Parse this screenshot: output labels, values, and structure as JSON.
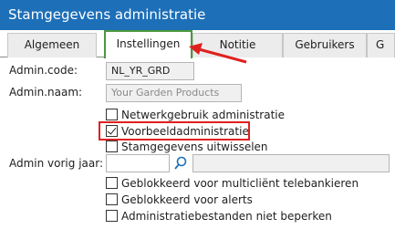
{
  "window": {
    "title": "Stamgegevens administratie"
  },
  "tabs": [
    {
      "label": "Algemeen"
    },
    {
      "label": "Instellingen"
    },
    {
      "label": "Notitie"
    },
    {
      "label": "Gebruikers"
    },
    {
      "label": "G"
    }
  ],
  "form": {
    "admin_code_label": "Admin.code:",
    "admin_code_value": "NL_YR_GRD",
    "admin_naam_label": "Admin.naam:",
    "admin_naam_value": "Your Garden Products",
    "admin_vorig_jaar_label": "Admin vorig jaar:",
    "admin_vorig_jaar_value": "",
    "admin_vorig_jaar_name": ""
  },
  "checkboxes": [
    {
      "label": "Netwerkgebruik administratie",
      "checked": false
    },
    {
      "label": "Voorbeeldadministratie",
      "checked": true
    },
    {
      "label": "Stamgegevens uitwisselen",
      "checked": false
    },
    {
      "label": "Geblokkeerd voor multicliënt telebankieren",
      "checked": false
    },
    {
      "label": "Geblokkeerd voor alerts",
      "checked": false
    },
    {
      "label": "Administratiebestanden niet beperken",
      "checked": false
    }
  ],
  "colors": {
    "titlebar": "#1d6fb8",
    "active_tab_border": "#4a9a3e",
    "annotation_red": "#e02020"
  },
  "icons": {
    "search": "search-icon"
  }
}
